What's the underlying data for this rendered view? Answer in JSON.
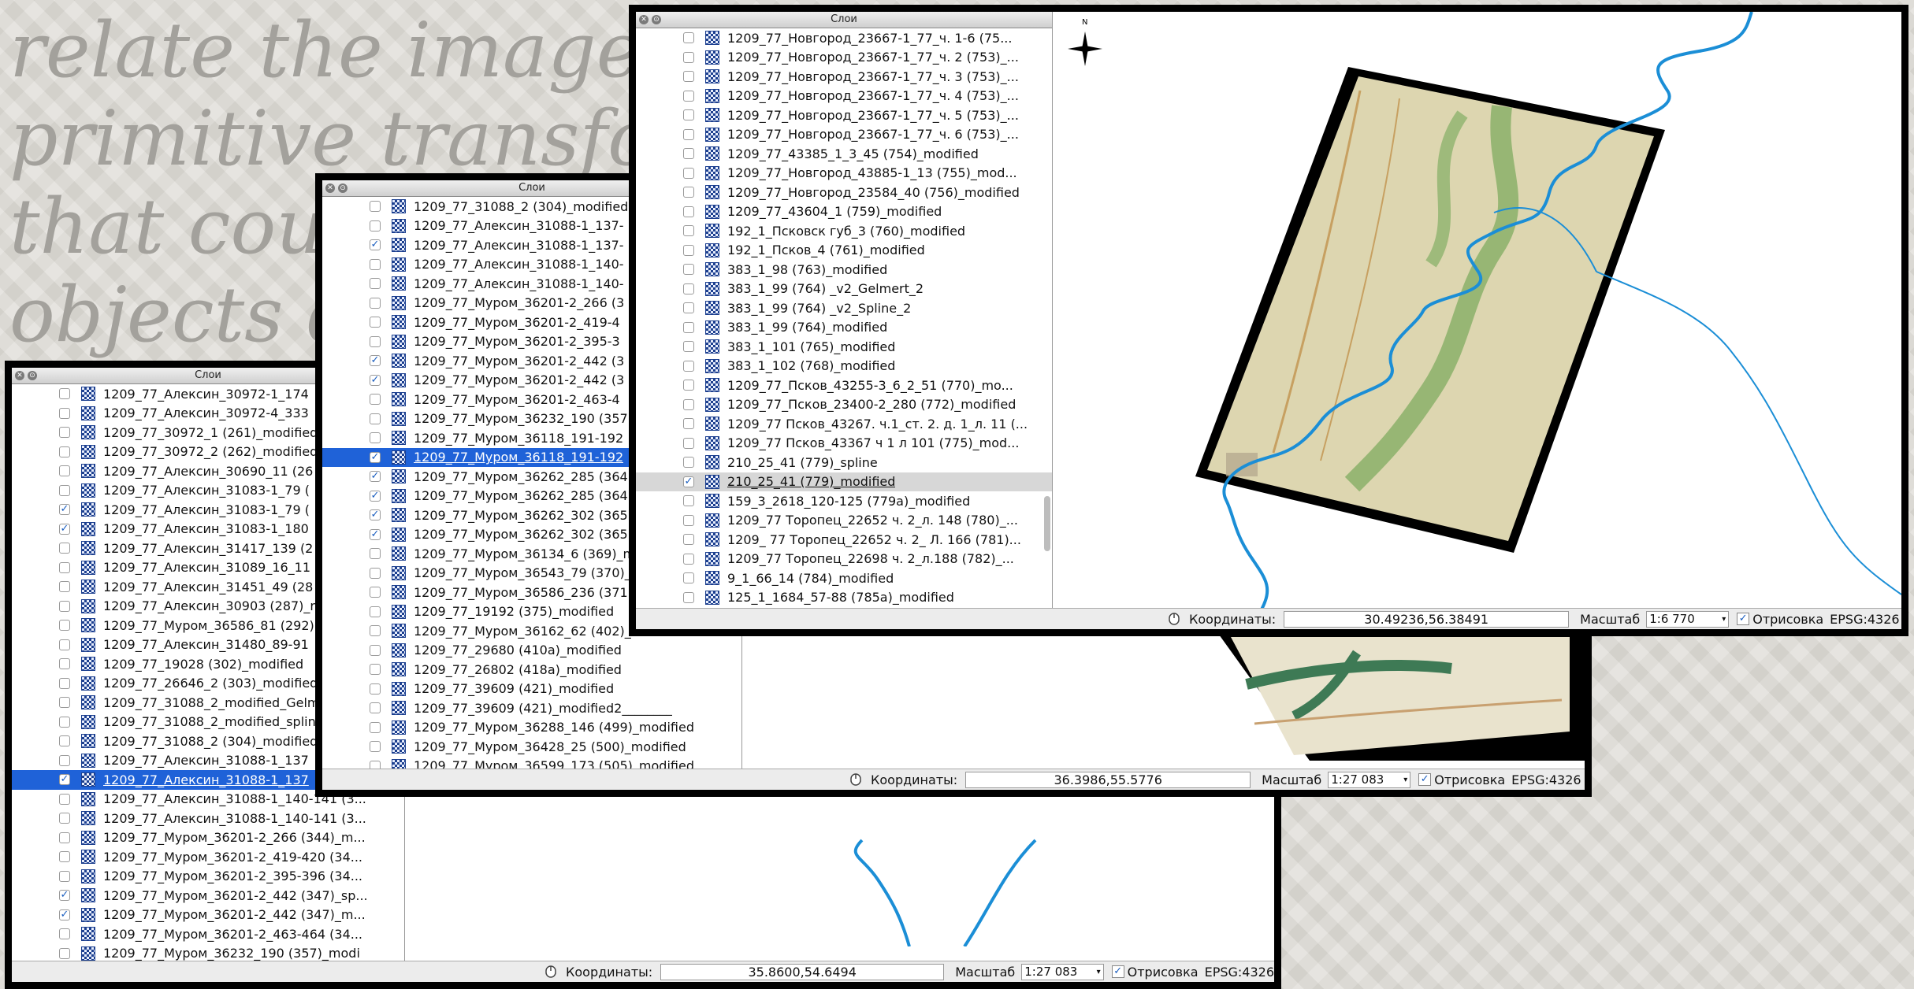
{
  "slide": {
    "lines": [
      "relate the images wi",
      "primitive transforma",
      "that could",
      "objects de"
    ]
  },
  "panel_title": "Слои",
  "status_labels": {
    "coords": "Координаты:",
    "scale": "Масштаб",
    "render": "Отрисовка",
    "crs": "EPSG:4326"
  },
  "win1": {
    "coords": "35.8600,54.6494",
    "scale": "1:27 083",
    "render_checked": true,
    "layers": [
      {
        "label": "1209_77_Алексин_30972-1_174",
        "checked": false
      },
      {
        "label": "1209_77_Алексин_30972-4_333",
        "checked": false
      },
      {
        "label": "1209_77_30972_1 (261)_modified",
        "checked": false
      },
      {
        "label": "1209_77_30972_2 (262)_modified",
        "checked": false
      },
      {
        "label": "1209_77_Алексин_30690_11 (26",
        "checked": false
      },
      {
        "label": "1209_77_Алексин_31083-1_79 (",
        "checked": false
      },
      {
        "label": "1209_77_Алексин_31083-1_79 (",
        "checked": true
      },
      {
        "label": "1209_77_Алексин_31083-1_180",
        "checked": true
      },
      {
        "label": "1209_77_Алексин_31417_139 (2",
        "checked": false
      },
      {
        "label": "1209_77_Алексин_31089_16_11",
        "checked": false
      },
      {
        "label": "1209_77_Алексин_31451_49 (28",
        "checked": false
      },
      {
        "label": "1209_77_Алексин_30903 (287)_r",
        "checked": false
      },
      {
        "label": "1209_77_Муром_36586_81 (292)",
        "checked": false
      },
      {
        "label": "1209_77_Алексин_31480_89-91",
        "checked": false
      },
      {
        "label": "1209_77_19028 (302)_modified",
        "checked": false
      },
      {
        "label": "1209_77_26646_2 (303)_modified",
        "checked": false
      },
      {
        "label": "1209_77_31088_2_modified_Gelm",
        "checked": false
      },
      {
        "label": "1209_77_31088_2_modified_splin",
        "checked": false
      },
      {
        "label": "1209_77_31088_2 (304)_modified",
        "checked": false
      },
      {
        "label": "1209_77_Алексин_31088-1_137",
        "checked": false
      },
      {
        "label": "1209_77_Алексин_31088-1_137",
        "checked": true,
        "selected": true
      },
      {
        "label": "1209_77_Алексин_31088-1_140-141 (3...",
        "checked": false
      },
      {
        "label": "1209_77_Алексин_31088-1_140-141 (3...",
        "checked": false
      },
      {
        "label": "1209_77_Муром_36201-2_266 (344)_m...",
        "checked": false
      },
      {
        "label": "1209_77_Муром_36201-2_419-420 (34...",
        "checked": false
      },
      {
        "label": "1209_77_Муром_36201-2_395-396 (34...",
        "checked": false
      },
      {
        "label": "1209_77_Муром_36201-2_442 (347)_sp...",
        "checked": true
      },
      {
        "label": "1209_77_Муром_36201-2_442 (347)_m...",
        "checked": true
      },
      {
        "label": "1209_77_Муром_36201-2_463-464 (34...",
        "checked": false
      },
      {
        "label": "1209_77_Муром_36232_190 (357)_modi",
        "checked": false
      }
    ]
  },
  "win2": {
    "coords": "36.3986,55.5776",
    "scale": "1:27 083",
    "render_checked": true,
    "layers": [
      {
        "label": "1209_77_31088_2 (304)_modified",
        "checked": false
      },
      {
        "label": "1209_77_Алексин_31088-1_137-",
        "checked": false
      },
      {
        "label": "1209_77_Алексин_31088-1_137-",
        "checked": true
      },
      {
        "label": "1209_77_Алексин_31088-1_140-",
        "checked": false
      },
      {
        "label": "1209_77_Алексин_31088-1_140-",
        "checked": false
      },
      {
        "label": "1209_77_Муром_36201-2_266 (3",
        "checked": false
      },
      {
        "label": "1209_77_Муром_36201-2_419-4",
        "checked": false
      },
      {
        "label": "1209_77_Муром_36201-2_395-3",
        "checked": false
      },
      {
        "label": "1209_77_Муром_36201-2_442 (3",
        "checked": true
      },
      {
        "label": "1209_77_Муром_36201-2_442 (3",
        "checked": true
      },
      {
        "label": "1209_77_Муром_36201-2_463-4",
        "checked": false
      },
      {
        "label": "1209_77_Муром_36232_190 (357",
        "checked": false
      },
      {
        "label": "1209_77_Муром_36118_191-192",
        "checked": false
      },
      {
        "label": "1209_77_Муром_36118_191-192",
        "checked": true,
        "selected": true
      },
      {
        "label": "1209_77_Муром_36262_285 (364",
        "checked": true
      },
      {
        "label": "1209_77_Муром_36262_285 (364",
        "checked": true
      },
      {
        "label": "1209_77_Муром_36262_302 (365",
        "checked": true
      },
      {
        "label": "1209_77_Муром_36262_302 (365",
        "checked": true
      },
      {
        "label": "1209_77_Муром_36134_6 (369)_m",
        "checked": false
      },
      {
        "label": "1209_77_Муром_36543_79 (370)_",
        "checked": false
      },
      {
        "label": "1209_77_Муром_36586_236 (371",
        "checked": false
      },
      {
        "label": "1209_77_19192 (375)_modified",
        "checked": false
      },
      {
        "label": "1209_77_Муром_36162_62 (402)_modified",
        "checked": false
      },
      {
        "label": "1209_77_29680 (410a)_modified",
        "checked": false
      },
      {
        "label": "1209_77_26802 (418a)_modified",
        "checked": false
      },
      {
        "label": "1209_77_39609 (421)_modified",
        "checked": false
      },
      {
        "label": "1209_77_39609 (421)_modified2________",
        "checked": false
      },
      {
        "label": "1209_77_Муром_36288_146 (499)_modified",
        "checked": false
      },
      {
        "label": "1209_77_Муром_36428_25 (500)_modified",
        "checked": false
      },
      {
        "label": "1209_77_Муром_36599_173 (505)_modified",
        "checked": false
      }
    ]
  },
  "win3": {
    "coords": "30.49236,56.38491",
    "scale": "1:6 770",
    "render_checked": true,
    "north_label": "N",
    "layers": [
      {
        "label": "1209_77_Новгород_23667-1_77_ч. 1-6 (75...",
        "checked": false
      },
      {
        "label": "1209_77_Новгород_23667-1_77_ч. 2 (753)_...",
        "checked": false
      },
      {
        "label": "1209_77_Новгород_23667-1_77_ч. 3 (753)_...",
        "checked": false
      },
      {
        "label": "1209_77_Новгород_23667-1_77_ч. 4 (753)_...",
        "checked": false
      },
      {
        "label": "1209_77_Новгород_23667-1_77_ч. 5 (753)_...",
        "checked": false
      },
      {
        "label": "1209_77_Новгород_23667-1_77_ч. 6 (753)_...",
        "checked": false
      },
      {
        "label": "1209_77_43385_1_3_45 (754)_modified",
        "checked": false
      },
      {
        "label": "1209_77_Новгород_43885-1_13 (755)_mod...",
        "checked": false
      },
      {
        "label": "1209_77_Новгород_23584_40 (756)_modified",
        "checked": false
      },
      {
        "label": "1209_77_43604_1 (759)_modified",
        "checked": false
      },
      {
        "label": "192_1_Псковск губ_3 (760)_modified",
        "checked": false
      },
      {
        "label": "192_1_Псков_4 (761)_modified",
        "checked": false
      },
      {
        "label": "383_1_98 (763)_modified",
        "checked": false
      },
      {
        "label": "383_1_99 (764) _v2_Gelmert_2",
        "checked": false
      },
      {
        "label": "383_1_99 (764) _v2_Spline_2",
        "checked": false
      },
      {
        "label": "383_1_99 (764)_modified",
        "checked": false
      },
      {
        "label": "383_1_101 (765)_modified",
        "checked": false
      },
      {
        "label": "383_1_102 (768)_modified",
        "checked": false
      },
      {
        "label": "1209_77_Псков_43255-3_6_2_51 (770)_mo...",
        "checked": false
      },
      {
        "label": "1209_77_Псков_23400-2_280 (772)_modified",
        "checked": false
      },
      {
        "label": "1209_77 Псков_43267. ч.1_ст. 2. д. 1_л. 11 (...",
        "checked": false
      },
      {
        "label": "1209_77 Псков_43367 ч 1 л 101 (775)_mod...",
        "checked": false
      },
      {
        "label": "210_25_41 (779)_spline",
        "checked": false
      },
      {
        "label": "210_25_41 (779)_modified",
        "checked": true,
        "gray": true
      },
      {
        "label": "159_3_2618_120-125 (779a)_modified",
        "checked": false
      },
      {
        "label": "1209_77 Торопец_22652 ч. 2_л. 148 (780)_...",
        "checked": false
      },
      {
        "label": "1209_ 77 Торопец_22652 ч. 2_ Л. 166 (781)...",
        "checked": false
      },
      {
        "label": "1209_77 Торопец_22698 ч. 2_л.188 (782)_...",
        "checked": false
      },
      {
        "label": "9_1_66_14 (784)_modified",
        "checked": false
      },
      {
        "label": "125_1_1684_57-88 (785a)_modified",
        "checked": false
      }
    ]
  }
}
